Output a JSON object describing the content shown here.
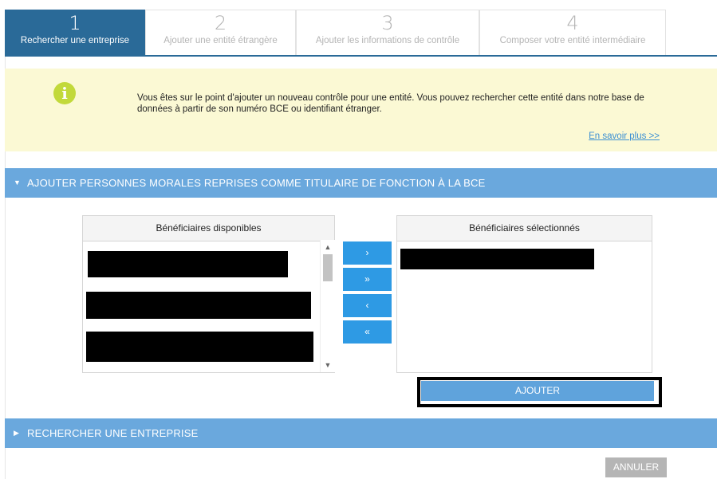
{
  "steps": [
    {
      "number": "1",
      "label": "Rechercher une entreprise",
      "active": true
    },
    {
      "number": "2",
      "label": "Ajouter une entité étrangère",
      "active": false
    },
    {
      "number": "3",
      "label": "Ajouter les informations de contrôle",
      "active": false
    },
    {
      "number": "4",
      "label": "Composer votre entité intermédiaire",
      "active": false
    }
  ],
  "info": {
    "icon": "info-icon",
    "message": "Vous êtes sur le point d'ajouter un nouveau contrôle pour une entité. Vous pouvez rechercher cette entité dans notre base de données à partir de son numéro BCE ou identifiant étranger.",
    "link": "En savoir plus >>"
  },
  "section_add": {
    "title": "AJOUTER PERSONNES MORALES REPRISES COMME TITULAIRE DE FONCTION À LA BCE",
    "expanded": true,
    "available_title": "Bénéficiaires disponibles",
    "selected_title": "Bénéficiaires sélectionnés",
    "move_buttons": {
      "move_one_right": "›",
      "move_all_right": "»",
      "move_one_left": "‹",
      "move_all_left": "«"
    },
    "add_label": "AJOUTER"
  },
  "section_search": {
    "title": "RECHERCHER UNE ENTREPRISE",
    "expanded": false
  },
  "cancel_label": "ANNULER",
  "colors": {
    "step_active": "#2a6a98",
    "panel_header": "#6aa8dd",
    "info_bg": "#fbf9d4",
    "move_button": "#2e9ae4",
    "info_icon": "#c2d93a"
  }
}
